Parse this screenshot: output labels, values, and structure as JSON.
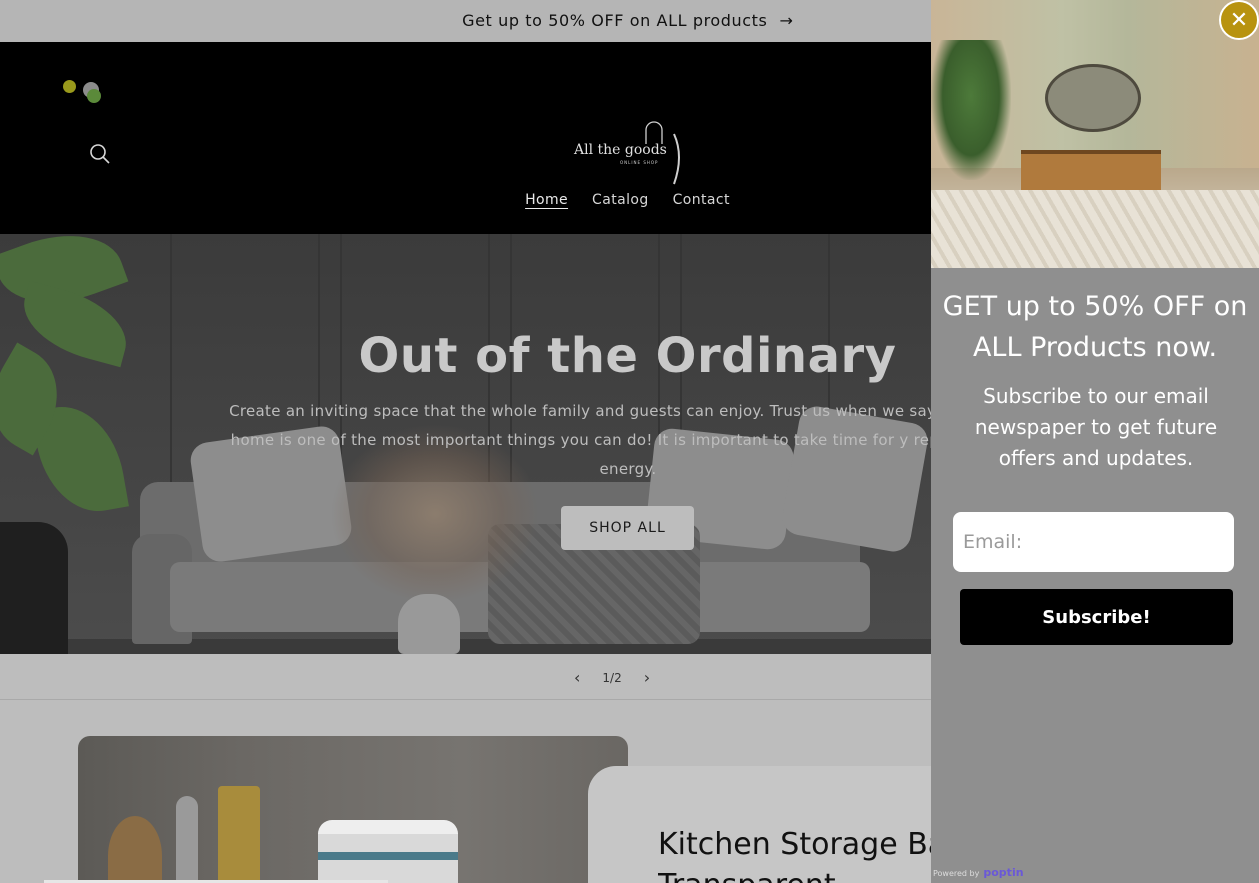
{
  "announcement": {
    "text": "Get up to 50% OFF on ALL products",
    "arrow": "→"
  },
  "header": {
    "logo": {
      "name": "All the goods",
      "tagline": "ONLINE SHOP"
    },
    "nav": [
      {
        "label": "Home",
        "active": true
      },
      {
        "label": "Catalog",
        "active": false
      },
      {
        "label": "Contact",
        "active": false
      }
    ]
  },
  "hero": {
    "title": "Out of the Ordinary",
    "description": "Create an inviting space that the whole family and guests can enjoy. Trust us when we say tho of your home is one of the most important things you can do! It is important to take time for y replenish your energy.",
    "button": "SHOP ALL"
  },
  "slider": {
    "counter": "1/2",
    "prev": "‹",
    "next": "›"
  },
  "feature": {
    "title_line1": "Kitchen Storage Ba",
    "title_line2": "Transparent"
  },
  "popup": {
    "close": "✕",
    "headline": "GET up to 50% OFF on ALL Products now.",
    "subtext": "Subscribe to our email newspaper to get future offers and updates.",
    "email_placeholder": "Email:",
    "button": "Subscribe!",
    "powered_by": "Powered by",
    "powered_brand": "poptin"
  },
  "colors": {
    "accent": "#b8930f",
    "popup_bg": "#8f8f8f",
    "header_bg": "#000000",
    "brand": "#6a58d8"
  },
  "icons": [
    "search-icon",
    "arrow-right-icon",
    "chevron-left-icon",
    "chevron-right-icon",
    "close-icon"
  ]
}
